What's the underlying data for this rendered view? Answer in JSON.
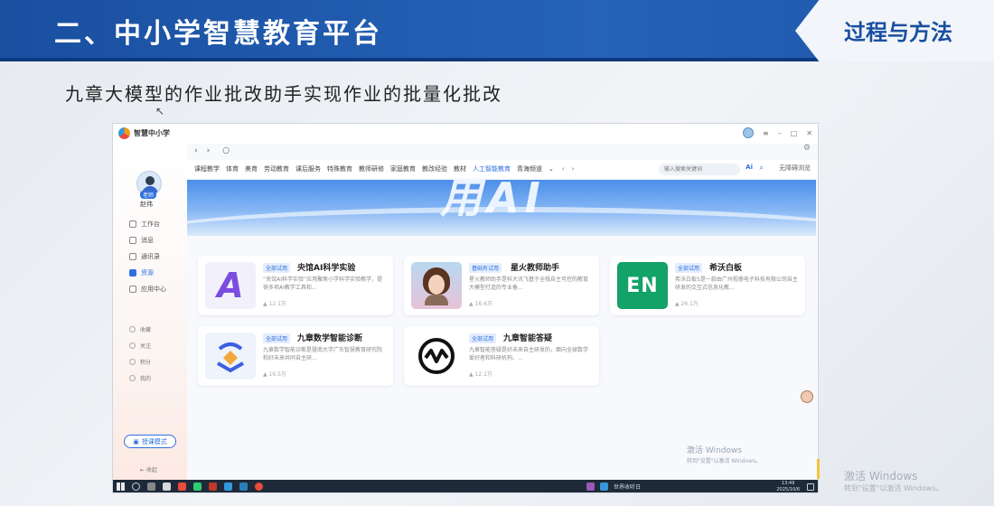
{
  "slide": {
    "title": "二、中小学智慧教育平台",
    "tag": "过程与方法",
    "subtitle": "九章大模型的作业批改助手实现作业的批量化批改"
  },
  "app": {
    "name": "智慧中小学",
    "nav": {
      "back": "‹",
      "forward": "›",
      "refresh": "○"
    }
  },
  "user": {
    "role": "老师",
    "name": "赵伟"
  },
  "sidebar": {
    "items": [
      {
        "label": "工作台"
      },
      {
        "label": "消息"
      },
      {
        "label": "通讯录"
      },
      {
        "label": "资源",
        "active": true
      },
      {
        "label": "应用中心"
      }
    ],
    "secondary": [
      {
        "label": "收藏"
      },
      {
        "label": "关注"
      },
      {
        "label": "积分"
      },
      {
        "label": "我的"
      }
    ],
    "mode_button": "授课模式",
    "collapse": "收起"
  },
  "categories": [
    {
      "label": "课程教学"
    },
    {
      "label": "体育"
    },
    {
      "label": "美育"
    },
    {
      "label": "劳动教育"
    },
    {
      "label": "课后服务"
    },
    {
      "label": "特殊教育"
    },
    {
      "label": "教师研修"
    },
    {
      "label": "家庭教育"
    },
    {
      "label": "教改经验"
    },
    {
      "label": "教材"
    },
    {
      "label": "人工智能教育",
      "active": true
    },
    {
      "label": "青海频道"
    }
  ],
  "search": {
    "placeholder": "输入搜索关键词",
    "ai_label": "Ai",
    "browse": "无障碍浏览"
  },
  "banner": {
    "text": "用AI"
  },
  "cards": [
    {
      "tag": "全部试用",
      "name": "央馆AI科学实验",
      "desc": "“央馆AI科学实验”应用聚焦小学科学实验教学，提供多项AI教学工具和...",
      "meta": "12.1万"
    },
    {
      "tag": "基础有试用",
      "name": "星火教师助手",
      "desc": "星火教师助手是科大讯飞基于全栈自主可控的教育大模型打造的专业备...",
      "meta": "16.6万"
    },
    {
      "tag": "全部试用",
      "name": "希沃白板",
      "desc": "希沃白板5是一款由广州视睿电子科技有限公司自主研发的交互式信息化教...",
      "meta": "26.1万"
    },
    {
      "tag": "全部试用",
      "name": "九章数学智能诊断",
      "desc": "九章数学智能诊断是暨南大学广东智慧教育研究院和好未来共同自主研...",
      "meta": "16.5万"
    },
    {
      "tag": "全部试用",
      "name": "九章智能答疑",
      "desc": "九章智能答疑是好未来自主研发的，面向全球数学爱好者和科研机构、...",
      "meta": "12.1万"
    }
  ],
  "taskbar": {
    "clock_time": "13:49",
    "clock_date": "2025/10/6",
    "weather": "世界收听日"
  },
  "watermark": {
    "title": "激活 Windows",
    "sub": "转到\"设置\"以激活 Windows。"
  },
  "colors": {
    "header_blue": "#1a4fa0",
    "accent": "#2f6fe0"
  }
}
